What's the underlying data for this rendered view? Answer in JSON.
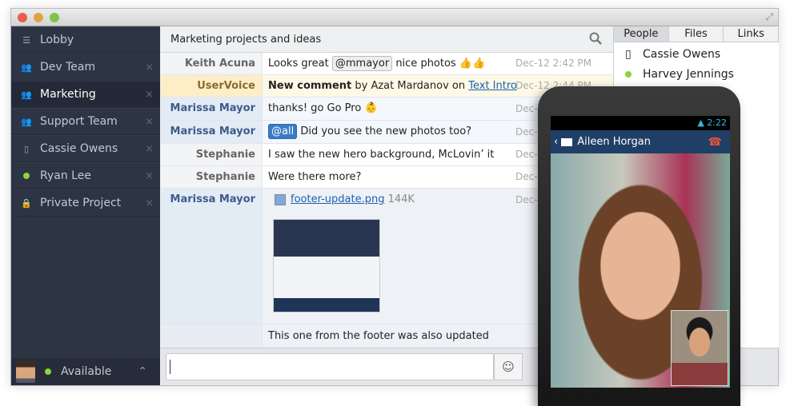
{
  "window": {
    "colors": {
      "close": "#ee5b50",
      "min": "#e0a446",
      "max": "#7cc44e"
    }
  },
  "sidebar": {
    "items": [
      {
        "label": "Lobby",
        "icon": "list-icon",
        "closable": false
      },
      {
        "label": "Dev Team",
        "icon": "group-icon",
        "closable": true
      },
      {
        "label": "Marketing",
        "icon": "group-icon",
        "closable": true,
        "active": true
      },
      {
        "label": "Support Team",
        "icon": "group-icon",
        "closable": true
      },
      {
        "label": "Cassie Owens",
        "icon": "mobile-icon",
        "closable": true
      },
      {
        "label": "Ryan Lee",
        "icon": "online-dot-icon",
        "closable": true
      },
      {
        "label": "Private Project",
        "icon": "lock-icon",
        "closable": true
      }
    ],
    "close_glyph": "×",
    "status": {
      "label": "Available",
      "chevron": "⌃"
    }
  },
  "main": {
    "title": "Marketing projects and ideas",
    "messages": [
      {
        "author": "Keith Acuna",
        "pre": "Looks great",
        "mention": "@mmayor",
        "post": "nice photos 👍👍",
        "time": "Dec-12 2:42 PM"
      },
      {
        "author": "UserVoice",
        "bold": "New comment",
        "mid": "by Azat Mardanov on",
        "link": "Text Intro",
        "time": "Dec-12 2:44 PM"
      },
      {
        "author": "Marissa Mayor",
        "text": "thanks! go Go Pro",
        "time": "Dec-"
      },
      {
        "author": "Marissa Mayor",
        "mention": "@all",
        "text": "Did you see the new photos too?",
        "time": "Dec-"
      },
      {
        "author": "Stephanie LaSala",
        "text": "I saw the new hero background, McLovin’ it",
        "time": "Dec-"
      },
      {
        "author": "Stephanie LaSala",
        "text": "Were there more?",
        "time": "Dec-"
      },
      {
        "author": "Marissa Mayor",
        "file": "footer-update.png",
        "size": "144K",
        "time": "Dec-"
      },
      {
        "author": "",
        "text": "This one from the footer was also updated"
      }
    ]
  },
  "input": {
    "value": "",
    "emoji": "☺"
  },
  "right": {
    "tabs": [
      "People",
      "Files",
      "Links"
    ],
    "people": [
      {
        "name": "Cassie Owens",
        "icon": "mobile-icon"
      },
      {
        "name": "Harvey Jennings",
        "icon": "online-dot-icon"
      }
    ]
  },
  "phone": {
    "time": "2:22",
    "caller": "Aileen Horgan"
  }
}
